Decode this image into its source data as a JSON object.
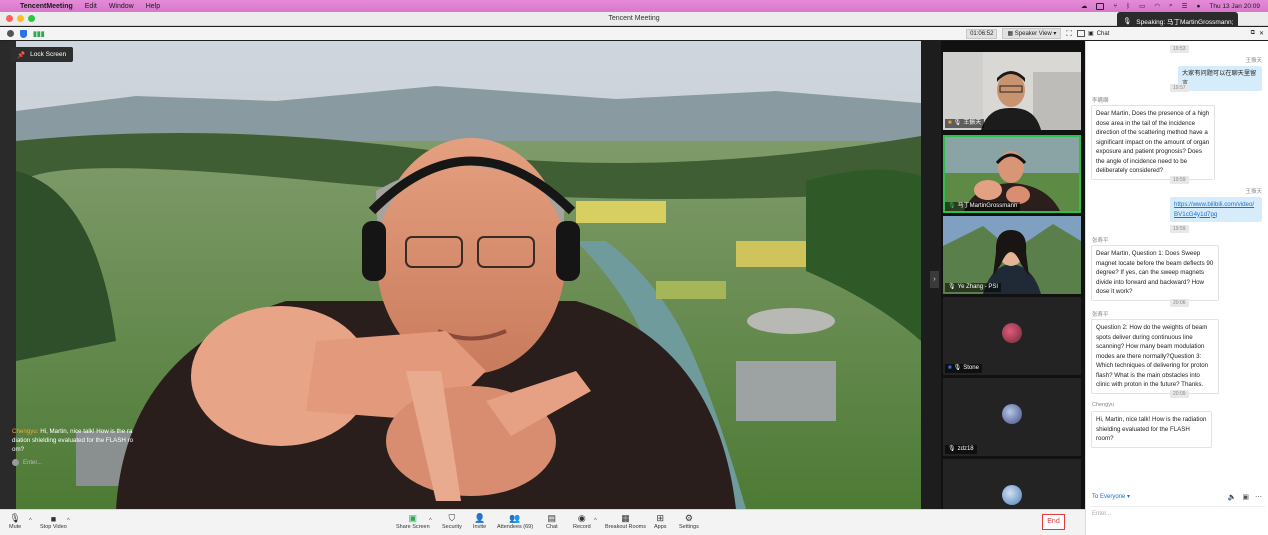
{
  "menubar": {
    "app_name": "TencentMeeting",
    "menus": [
      "Edit",
      "Window",
      "Help"
    ],
    "clock": "Thu 13 Jan  20:09"
  },
  "window": {
    "title": "Tencent Meeting"
  },
  "toolbar": {
    "timer": "01:06:52",
    "view": "Speaker View"
  },
  "speaking": {
    "label": "Speaking: 马丁MartinGrossmann;"
  },
  "chat_header": {
    "title": "Chat"
  },
  "main": {
    "lock_screen": "Lock Screen",
    "overlay_sender": "Chengyu:",
    "overlay_message": "Hi, Martin, nice talk! How is the ra diation shielding evaluated for the FLASH ro om?",
    "enter_placeholder": "Enter..."
  },
  "participants": [
    {
      "name": "王振天",
      "muted": true,
      "kind": "video"
    },
    {
      "name": "马丁MartinGrossmann",
      "muted": false,
      "kind": "video",
      "active": true
    },
    {
      "name": "Ye Zhang - PSI",
      "muted": true,
      "kind": "video"
    },
    {
      "name": "Stone",
      "muted": true,
      "kind": "avatar"
    },
    {
      "name": "zdz18",
      "muted": true,
      "kind": "avatar"
    },
    {
      "name": "",
      "muted": true,
      "kind": "avatar"
    }
  ],
  "controls": {
    "mute": "Mute",
    "stop_video": "Stop Video",
    "share_screen": "Share Screen",
    "security": "Security",
    "invite": "Invite",
    "attendees": "Attendees (69)",
    "chat": "Chat",
    "record": "Record",
    "breakout": "Breakout Rooms",
    "apps": "Apps",
    "settings": "Settings",
    "end": "End"
  },
  "chat": {
    "messages": [
      {
        "time": "19:53",
        "sender": "王振天",
        "side": "right",
        "text": "大家有问题可以在聊天里留言"
      },
      {
        "time": "19:57",
        "sender": "李瞒瞒",
        "side": "left",
        "text": "Dear Martin, Does the presence of a high dose area in the tail of the incidence direction of the scattering method have a significant impact on the amount of organ exposure and patient prognosis? Does the angle of incidence need to be deliberately considered?"
      },
      {
        "time": "19:59",
        "sender": "王振天",
        "side": "right",
        "text": "https://www.bilibili.com/video/BV1cG4y1d7pq",
        "link": true
      },
      {
        "time": "19:59",
        "sender": "张寿平",
        "side": "left",
        "text": "Dear Martin, Question 1: Does Sweep magnet locate before the beam deflects 90 degree? If yes, can the sweep magnets divide into forward and backward? How dose it work?"
      },
      {
        "time": "20:06",
        "sender": "张寿平",
        "side": "left",
        "text": "Question 2: How do the weights of beam spots deliver during continuous line scanning? How many beam modulation modes are there normally?Question 3: Which techniques of delivering for proton flash? What is the main obstacles into clinic with proton in the future? Thanks."
      },
      {
        "time": "20:09",
        "sender": "Chengyu",
        "side": "left",
        "text": "Hi, Martin, nice talk! How is the radiation shielding evaluated for the FLASH room?"
      }
    ],
    "to_label": "To",
    "to_value": "Everyone",
    "input_placeholder": "Enter..."
  }
}
